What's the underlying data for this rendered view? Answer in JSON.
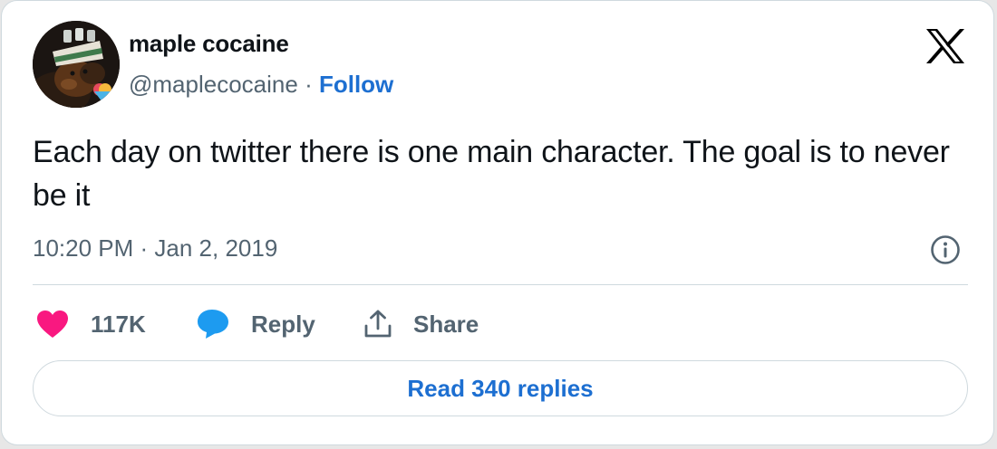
{
  "author": {
    "display_name": "maple cocaine",
    "handle": "@maplecocaine",
    "separator": "·",
    "follow_label": "Follow",
    "avatar_icon": "dog-with-hat-avatar"
  },
  "brand": {
    "logo_icon": "x-logo-icon"
  },
  "tweet": {
    "text": "Each day on twitter there is one main character. The goal is to never be it",
    "timestamp": "10:20 PM · Jan 2, 2019"
  },
  "actions": {
    "like_count": "117K",
    "reply_label": "Reply",
    "share_label": "Share"
  },
  "read_replies_label": "Read 340 replies",
  "colors": {
    "like": "#f91880",
    "reply": "#1d9bf0",
    "link": "#1d6fd1",
    "muted": "#536471",
    "border": "#cfd9de"
  }
}
